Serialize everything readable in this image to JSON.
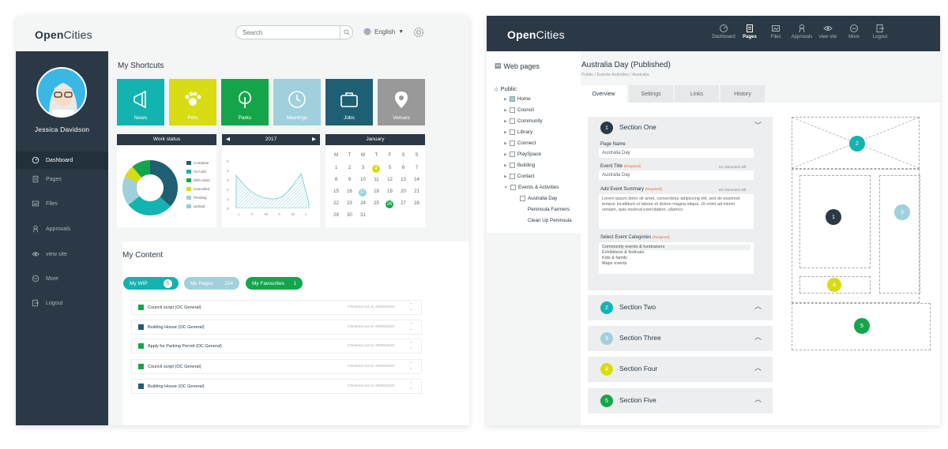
{
  "left": {
    "logo": {
      "bold": "Open",
      "rest": "Cities"
    },
    "search_placeholder": "Search",
    "language": "English",
    "user_name": "Jessica Davidson",
    "nav": [
      {
        "label": "Dashboard",
        "icon": "dashboard-icon",
        "active": true
      },
      {
        "label": "Pages",
        "icon": "pages-icon"
      },
      {
        "label": "Files",
        "icon": "files-icon"
      },
      {
        "label": "Approvals",
        "icon": "approvals-icon"
      },
      {
        "label": "view site",
        "icon": "eye-icon"
      },
      {
        "label": "More",
        "icon": "more-icon"
      },
      {
        "label": "Logout",
        "icon": "logout-icon"
      }
    ],
    "shortcuts_title": "My Shortcuts",
    "tiles": [
      {
        "label": "News",
        "color": "#13b3b0",
        "icon": "megaphone-icon"
      },
      {
        "label": "Pets",
        "color": "#d7dd12",
        "icon": "paw-icon"
      },
      {
        "label": "Parks",
        "color": "#14a54b",
        "icon": "tree-icon"
      },
      {
        "label": "Meetings",
        "color": "#9fd0dc",
        "icon": "clock-icon"
      },
      {
        "label": "Jobs",
        "color": "#1f5f73",
        "icon": "briefcase-icon"
      },
      {
        "label": "Venues",
        "color": "#999999",
        "icon": "location-pin-icon"
      }
    ],
    "work_status": {
      "title": "Work status",
      "legend": [
        "Complete",
        "On hold",
        "With client",
        "Cancelled",
        "Pending",
        "Upload"
      ]
    },
    "year_widget": {
      "year": "2017",
      "months": [
        "J",
        "F",
        "M",
        "A",
        "M",
        "J"
      ],
      "yticks": [
        "5",
        "4",
        "3",
        "2",
        "1",
        "0"
      ]
    },
    "calendar": {
      "month": "January",
      "days": [
        "M",
        "T",
        "W",
        "T",
        "F",
        "S",
        "S"
      ],
      "rows": [
        [
          "1",
          "2",
          "3",
          "4",
          "5",
          "6",
          "7"
        ],
        [
          "8",
          "9",
          "10",
          "11",
          "12",
          "13",
          "14"
        ],
        [
          "15",
          "16",
          "17",
          "18",
          "19",
          "20",
          "21"
        ],
        [
          "22",
          "23",
          "24",
          "25",
          "26",
          "27",
          "28"
        ],
        [
          "29",
          "30",
          "31",
          "",
          "",
          "",
          ""
        ]
      ]
    },
    "content_title": "My Content",
    "pills": [
      {
        "label": "My WIP",
        "count": "5",
        "color": "#13b3b0"
      },
      {
        "label": "My Pages",
        "count": "224",
        "color": "#9fd0dc"
      },
      {
        "label": "My Favourites",
        "count": "1",
        "color": "#14a54b"
      }
    ],
    "content_rows": [
      {
        "title": "Council script (OC General)",
        "date": "Checked out on 28/06/2016"
      },
      {
        "title": "Building House (OC General)",
        "date": "Checked out on 28/06/2016"
      },
      {
        "title": "Apply for Parking Permit (OC General)",
        "date": "Checked out on 28/06/2016"
      },
      {
        "title": "Council script (OC General)",
        "date": "Checked out on 28/06/2016"
      },
      {
        "title": "Building House (OC General)",
        "date": "Checked out on 28/06/2016"
      }
    ]
  },
  "right": {
    "logo": {
      "bold": "Open",
      "rest": "Cities"
    },
    "top_nav": [
      {
        "label": "Dashboard",
        "icon": "dashboard-icon"
      },
      {
        "label": "Pages",
        "icon": "pages-icon",
        "active": true
      },
      {
        "label": "Files",
        "icon": "files-icon"
      },
      {
        "label": "Approvals",
        "icon": "approvals-icon"
      },
      {
        "label": "view site",
        "icon": "eye-icon"
      },
      {
        "label": "More",
        "icon": "more-icon"
      },
      {
        "label": "Logout",
        "icon": "logout-icon"
      }
    ],
    "sidebar_title": "Web pages",
    "tree_root": "Public",
    "tree": [
      "Home",
      "Council",
      "Community",
      "Library",
      "Connect",
      "PlaySpace",
      "Building",
      "Contact",
      "Events & Activities"
    ],
    "tree_children": [
      "Australia Day",
      "Peninsula Farmers",
      "Clean Up Peninsula"
    ],
    "page_title": "Australia Day (Published)",
    "breadcrumb": "Public  /  Events-Activities  /  Australia",
    "tabs": [
      "Overview",
      "Settings",
      "Links",
      "History"
    ],
    "section_one": {
      "num": "1",
      "title": "Section One",
      "page_name_label": "Page Name",
      "page_name": "Australia Day",
      "event_title_label": "Event Title",
      "required": "(Required)",
      "event_title_count": "52 characters left",
      "event_title": "Australia Day",
      "summary_label": "Add Event Summary",
      "summary_count": "80 characters left",
      "summary": "Lorem ipsum dolor sit amet, consectetur adipiscing elit, sed do eiusmod tempor incididunt ut labore et dolore magna aliqua. Ut enim ad minim veniam, quis nostrud exercitation, ullamco",
      "categories_label": "Select Event Categories",
      "categories": [
        "Community events & fundraisers",
        "Exhibitions & festivals",
        "Kids & family",
        "Major events"
      ]
    },
    "sections": [
      {
        "num": "2",
        "title": "Section Two",
        "color": "#13b3b0"
      },
      {
        "num": "3",
        "title": "Section Three",
        "color": "#9fd0dc"
      },
      {
        "num": "4",
        "title": "Section Four",
        "color": "#d7dd12"
      },
      {
        "num": "5",
        "title": "Section Five",
        "color": "#14a54b"
      }
    ],
    "wire": {
      "n1": "1",
      "n2": "2",
      "n3": "3",
      "n4": "4",
      "n5": "5"
    }
  }
}
